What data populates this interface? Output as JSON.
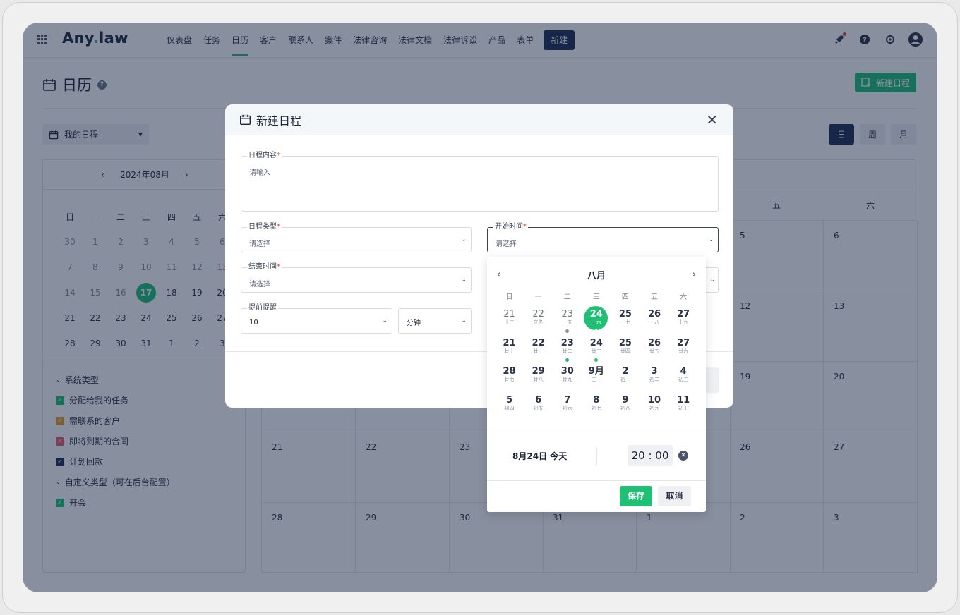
{
  "app": {
    "logo_a": "Any",
    "logo_dot": ".",
    "logo_b": "law"
  },
  "nav": [
    "仪表盘",
    "任务",
    "日历",
    "客户",
    "联系人",
    "案件",
    "法律咨询",
    "法律文档",
    "法律诉讼",
    "产品",
    "表单"
  ],
  "nav_new": "新建",
  "page": {
    "title": "日历",
    "new_schedule": "新建日程",
    "my_schedule": "我的日程",
    "views": [
      "日",
      "周",
      "月"
    ]
  },
  "mini_cal": {
    "month_label": "2024年08月",
    "weekdays": [
      "日",
      "一",
      "二",
      "三",
      "四",
      "五",
      "六"
    ],
    "weeks": [
      [
        "30",
        "1",
        "2",
        "3",
        "4",
        "5",
        "6"
      ],
      [
        "7",
        "8",
        "9",
        "10",
        "11",
        "12",
        "13"
      ],
      [
        "14",
        "15",
        "16",
        "17",
        "18",
        "19",
        "20"
      ],
      [
        "21",
        "22",
        "23",
        "24",
        "25",
        "26",
        "27"
      ],
      [
        "28",
        "29",
        "30",
        "31",
        "1",
        "2",
        "3"
      ]
    ]
  },
  "legend": {
    "system_label": "系统类型",
    "system_items": [
      {
        "label": "分配给我的任务",
        "color": "#1fbf74"
      },
      {
        "label": "需联系的客户",
        "color": "#e0a030"
      },
      {
        "label": "即将到期的合同",
        "color": "#e06070"
      },
      {
        "label": "计划回款",
        "color": "#1f2f52"
      }
    ],
    "custom_label": "自定义类型（可在后台配置）",
    "custom_items": [
      {
        "label": "开会",
        "color": "#1fbf74"
      }
    ]
  },
  "big_cal": {
    "headers_visible": {
      "fri": "五",
      "sat": "六"
    },
    "rows": [
      {
        "fri": "5",
        "sat": "6"
      },
      {
        "fri": "12",
        "sat": "13"
      },
      {
        "fri": "19",
        "sat": "20"
      },
      {
        "sun": "21",
        "mon": "22",
        "tue": "23",
        "fri": "26",
        "sat": "27"
      },
      {
        "sun": "28",
        "mon": "29",
        "tue": "30",
        "wed": "31",
        "thu": "1",
        "fri": "2",
        "sat": "3"
      }
    ]
  },
  "modal": {
    "title": "新建日程",
    "content_label": "日程内容",
    "content_placeholder": "请输入",
    "type_label": "日程类型",
    "type_placeholder": "请选择",
    "start_label": "开始时间",
    "start_placeholder": "请选择",
    "end_label": "结束时间",
    "end_placeholder": "请选择",
    "remind_label": "提前提醒",
    "remind_value": "10",
    "remind_unit": "分钟",
    "required_mark": "*"
  },
  "datepicker": {
    "month": "八月",
    "weekdays": [
      "日",
      "一",
      "二",
      "三",
      "四",
      "五",
      "六"
    ],
    "weeks": [
      [
        {
          "n": "21",
          "l": "十三",
          "gray": true
        },
        {
          "n": "22",
          "l": "立冬",
          "gray": true
        },
        {
          "n": "23",
          "l": "十五",
          "gray": true,
          "dot": "#8a909c"
        },
        {
          "n": "24",
          "l": "十六",
          "sel": true,
          "dot": "#1fbf74"
        },
        {
          "n": "25",
          "l": "十七"
        },
        {
          "n": "26",
          "l": "十八"
        },
        {
          "n": "27",
          "l": "十九"
        }
      ],
      [
        {
          "n": "21",
          "l": "廿十"
        },
        {
          "n": "22",
          "l": "廿一"
        },
        {
          "n": "23",
          "l": "廿二",
          "dot": "#1fbf74"
        },
        {
          "n": "24",
          "l": "廿三",
          "dot": "#1fbf74"
        },
        {
          "n": "25",
          "l": "廿四"
        },
        {
          "n": "26",
          "l": "廿五"
        },
        {
          "n": "27",
          "l": "廿六"
        }
      ],
      [
        {
          "n": "28",
          "l": "廿七"
        },
        {
          "n": "29",
          "l": "廿八"
        },
        {
          "n": "30",
          "l": "廿九"
        },
        {
          "n": "9月",
          "l": "三十"
        },
        {
          "n": "2",
          "l": "初一"
        },
        {
          "n": "3",
          "l": "初二"
        },
        {
          "n": "4",
          "l": "初三"
        }
      ],
      [
        {
          "n": "5",
          "l": "初四"
        },
        {
          "n": "6",
          "l": "初五"
        },
        {
          "n": "7",
          "l": "初六"
        },
        {
          "n": "8",
          "l": "初七"
        },
        {
          "n": "9",
          "l": "初八"
        },
        {
          "n": "10",
          "l": "初九"
        },
        {
          "n": "11",
          "l": "初十"
        }
      ]
    ],
    "date_label": "8月24日 今天",
    "time": "20 : 00",
    "save": "保存",
    "cancel": "取消"
  },
  "colors": {
    "accent": "#1fbf74",
    "navy": "#1f2f52",
    "overlay": "rgba(17,31,64,0.5)"
  }
}
